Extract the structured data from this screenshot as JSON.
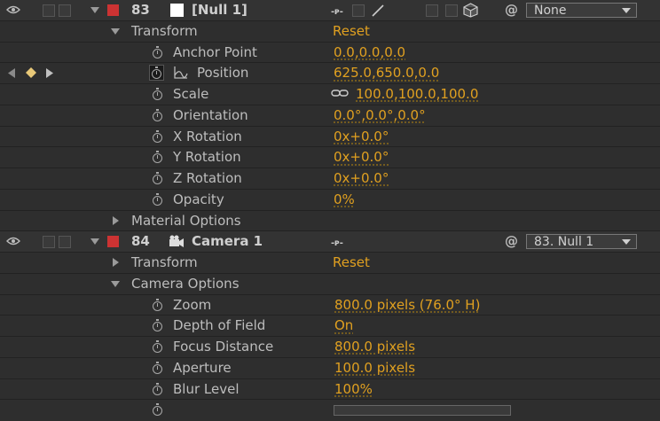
{
  "colors": {
    "value": "#e0a020",
    "label_red": "#cc3333",
    "label_white": "#ffffff"
  },
  "layer83": {
    "number": "83",
    "name": "[Null 1]",
    "parent_value": "None",
    "switch_icons": [
      "shy-icon",
      "pencil-icon",
      "3d-cube-icon"
    ],
    "transform": {
      "label": "Transform",
      "reset": "Reset",
      "properties": [
        {
          "label": "Anchor Point",
          "value": "0.0,0.0,0.0"
        },
        {
          "label": "Position",
          "value": "625.0,650.0,0.0",
          "keyframed": true
        },
        {
          "label": "Scale",
          "value": "100.0,100.0,100.0",
          "linked": true
        },
        {
          "label": "Orientation",
          "value": "0.0°,0.0°,0.0°"
        },
        {
          "label": "X Rotation",
          "value": "0x+0.0°"
        },
        {
          "label": "Y Rotation",
          "value": "0x+0.0°"
        },
        {
          "label": "Z Rotation",
          "value": "0x+0.0°"
        },
        {
          "label": "Opacity",
          "value": "0%"
        }
      ]
    },
    "material_options": "Material Options"
  },
  "layer84": {
    "number": "84",
    "name": "Camera 1",
    "parent_value": "83. Null 1",
    "transform": {
      "label": "Transform",
      "reset": "Reset"
    },
    "camera_options": {
      "label": "Camera Options",
      "properties": [
        {
          "label": "Zoom",
          "value": "800.0 pixels (76.0° H)"
        },
        {
          "label": "Depth of Field",
          "value": "On"
        },
        {
          "label": "Focus Distance",
          "value": "800.0 pixels"
        },
        {
          "label": "Aperture",
          "value": "100.0 pixels"
        },
        {
          "label": "Blur Level",
          "value": "100%"
        }
      ]
    }
  }
}
